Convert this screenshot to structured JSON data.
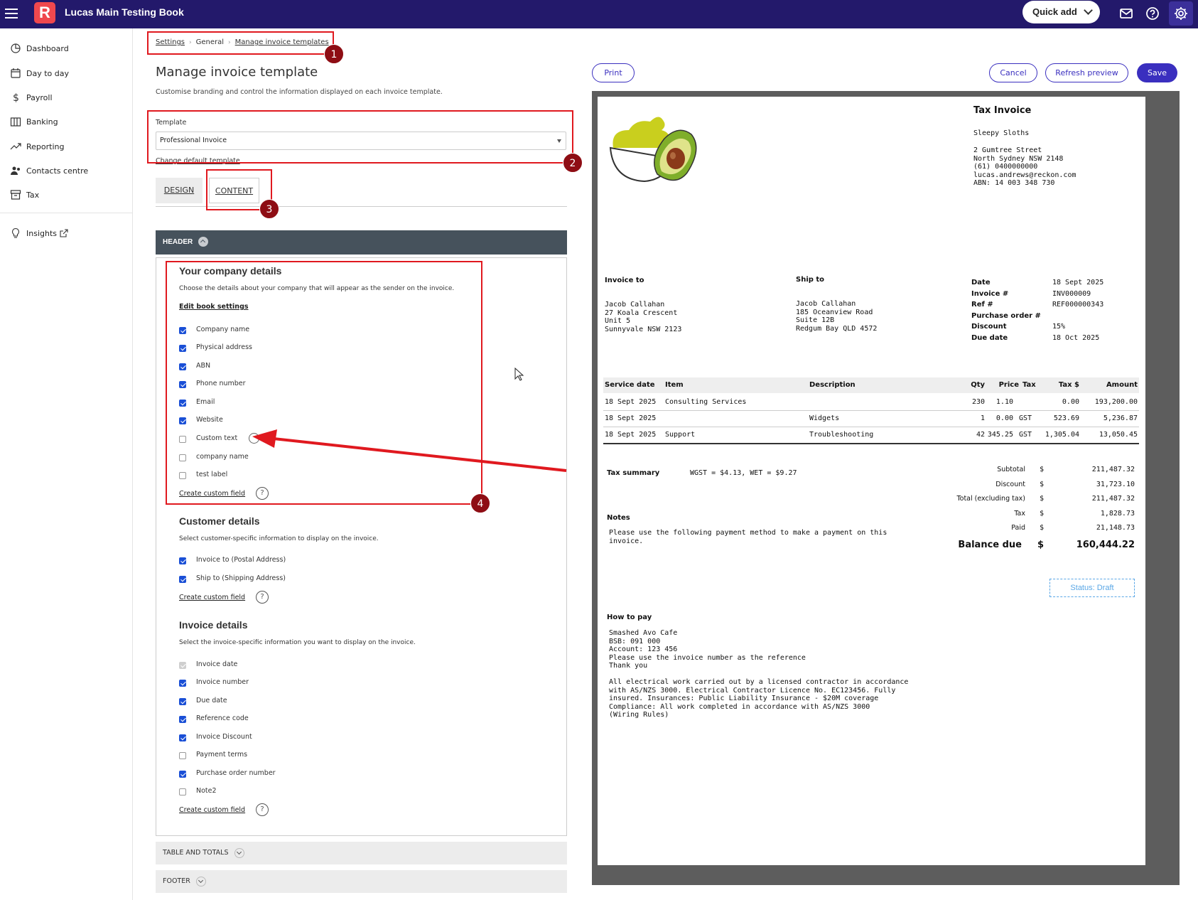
{
  "topbar": {
    "logo_letter": "R",
    "book_name": "Lucas Main Testing Book",
    "quick_add": "Quick add"
  },
  "sidebar": {
    "items": [
      {
        "label": "Dashboard",
        "icon": "pie-chart-icon"
      },
      {
        "label": "Day to day",
        "icon": "calendar-icon"
      },
      {
        "label": "Payroll",
        "icon": "dollar-icon"
      },
      {
        "label": "Banking",
        "icon": "bank-icon"
      },
      {
        "label": "Reporting",
        "icon": "trend-icon"
      },
      {
        "label": "Contacts centre",
        "icon": "people-icon"
      },
      {
        "label": "Tax",
        "icon": "tax-box-icon"
      },
      {
        "label": "Insights",
        "icon": "lightbulb-icon"
      }
    ]
  },
  "breadcrumb": [
    "Settings",
    "General",
    "Manage invoice templates"
  ],
  "page": {
    "title": "Manage invoice template",
    "subtitle": "Customise branding and control the information displayed on each invoice template.",
    "template_label": "Template",
    "template_value": "Professional Invoice",
    "change_default": "Change default template",
    "tabs": [
      "DESIGN",
      "CONTENT"
    ],
    "header_section": "HEADER"
  },
  "annotations": [
    "1",
    "2",
    "3",
    "4"
  ],
  "company": {
    "title": "Your company details",
    "desc": "Choose the details about your company that will appear as the sender on the invoice.",
    "edit_link": "Edit book settings",
    "fields": [
      {
        "label": "Company name",
        "checked": true
      },
      {
        "label": "Physical address",
        "checked": true
      },
      {
        "label": "ABN",
        "checked": true
      },
      {
        "label": "Phone number",
        "checked": true
      },
      {
        "label": "Email",
        "checked": true
      },
      {
        "label": "Website",
        "checked": true
      },
      {
        "label": "Custom text",
        "checked": false
      },
      {
        "label": "company name",
        "checked": false
      },
      {
        "label": "test label",
        "checked": false
      }
    ],
    "create_link": "Create custom field"
  },
  "customer": {
    "title": "Customer details",
    "desc": "Select customer-specific information to display on the invoice.",
    "fields": [
      {
        "label": "Invoice to (Postal Address)",
        "checked": true
      },
      {
        "label": "Ship to (Shipping Address)",
        "checked": true
      }
    ],
    "create_link": "Create custom field"
  },
  "invoice": {
    "title": "Invoice details",
    "desc": "Select the invoice-specific information you want to display on the invoice.",
    "fields": [
      {
        "label": "Invoice date",
        "checked": true,
        "disabled": true
      },
      {
        "label": "Invoice number",
        "checked": true
      },
      {
        "label": "Due date",
        "checked": true
      },
      {
        "label": "Reference code",
        "checked": true
      },
      {
        "label": "Invoice Discount",
        "checked": true
      },
      {
        "label": "Payment terms",
        "checked": false
      },
      {
        "label": "Purchase order number",
        "checked": true
      },
      {
        "label": "Note2",
        "checked": false
      }
    ],
    "create_link": "Create custom field"
  },
  "collapsed_sections": [
    "TABLE AND TOTALS",
    "FOOTER"
  ],
  "actions": {
    "print": "Print",
    "cancel": "Cancel",
    "refresh": "Refresh preview",
    "save": "Save"
  },
  "doc": {
    "title": "Tax Invoice",
    "company": "Sleepy Sloths",
    "address": [
      "2 Gumtree Street",
      "North Sydney NSW 2148",
      "(61) 0400000000",
      "lucas.andrews@reckon.com",
      "ABN: 14 003 348 730"
    ],
    "invoice_to_label": "Invoice to",
    "invoice_to": [
      "Jacob Callahan",
      "27 Koala Crescent",
      "Unit 5",
      "Sunnyvale NSW 2123"
    ],
    "ship_to_label": "Ship to",
    "ship_to": [
      "Jacob Callahan",
      "185 Oceanview Road",
      "Suite 12B",
      "Redgum Bay QLD 4572"
    ],
    "meta": [
      {
        "k": "Date",
        "v": "18 Sept 2025"
      },
      {
        "k": "Invoice #",
        "v": "INV000009"
      },
      {
        "k": "Ref #",
        "v": "REF000000343"
      },
      {
        "k": "Purchase order #",
        "v": ""
      },
      {
        "k": "Discount",
        "v": "15%"
      },
      {
        "k": "Due date",
        "v": "18 Oct 2025"
      }
    ],
    "columns": [
      "Service date",
      "Item",
      "Description",
      "Qty",
      "Price",
      "Tax",
      "Tax $",
      "Amount"
    ],
    "rows": [
      [
        "18 Sept 2025",
        "Consulting Services",
        "",
        "230",
        "1.10",
        "",
        "0.00",
        "193,200.00"
      ],
      [
        "18 Sept 2025",
        "",
        "Widgets",
        "1",
        "0.00",
        "GST",
        "523.69",
        "5,236.87"
      ],
      [
        "18 Sept 2025",
        "Support",
        "Troubleshooting",
        "42",
        "345.25",
        "GST",
        "1,305.04",
        "13,050.45"
      ]
    ],
    "tax_summary_label": "Tax summary",
    "tax_summary": "WGST = $4.13, WET = $9.27",
    "totals": [
      {
        "k": "Subtotal",
        "c": "$",
        "v": "211,487.32"
      },
      {
        "k": "Discount",
        "c": "$",
        "v": "31,723.10"
      },
      {
        "k": "Total (excluding tax)",
        "c": "$",
        "v": "211,487.32"
      },
      {
        "k": "Tax",
        "c": "$",
        "v": "1,828.73"
      },
      {
        "k": "Paid",
        "c": "$",
        "v": "21,148.73"
      }
    ],
    "balance_label": "Balance due",
    "balance_currency": "$",
    "balance": "160,444.22",
    "notes_label": "Notes",
    "notes": [
      "Please use the following payment method to make a payment on this",
      "invoice."
    ],
    "status": "Status: Draft",
    "how_label": "How to pay",
    "how": [
      "Smashed Avo Cafe",
      "BSB: 091 000",
      "Account: 123 456",
      "Please use the invoice number as the reference",
      "Thank you",
      "",
      "All electrical work carried out by a licensed contractor in accordance",
      "with AS/NZS 3000. Electrical Contractor Licence No. EC123456. Fully",
      "insured. Insurances: Public Liability Insurance - $20M coverage",
      "Compliance: All work completed in accordance with AS/NZS 3000",
      "(Wiring Rules)"
    ]
  },
  "colors": {
    "topbar": "#23196b",
    "accent": "#3a2fbf",
    "annotation": "#e0191f",
    "badge": "#8e0d14",
    "status": "#5aa7e6"
  }
}
